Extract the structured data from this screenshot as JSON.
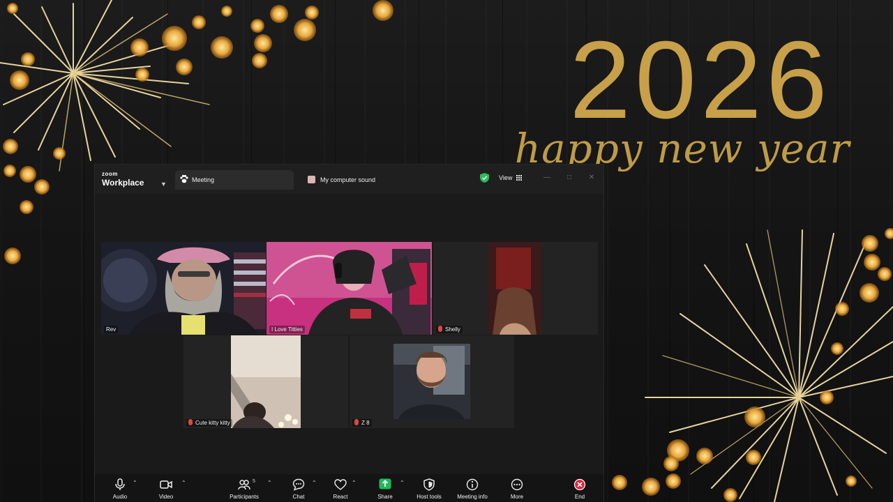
{
  "wallpaper": {
    "year": "2026",
    "greeting": "happy new year",
    "gold": "#c7a049"
  },
  "app": {
    "logo_small": "zoom",
    "logo_big": "Workplace"
  },
  "tabs": {
    "meeting_label": "Meeting",
    "sound_label": "My computer sound"
  },
  "header": {
    "view_label": "View",
    "security_color": "#2dba5a"
  },
  "participants": {
    "rev": "Rev",
    "active": "I Love Titties",
    "shelly": "Shelly",
    "cute": "Cute kitty kitty",
    "z8": "Z 8"
  },
  "toolbar": {
    "audio": "Audio",
    "video": "Video",
    "participants": "Participants",
    "participants_count": "5",
    "chat": "Chat",
    "react": "React",
    "share": "Share",
    "host_tools": "Host tools",
    "meeting_info": "Meeting info",
    "more": "More",
    "end": "End",
    "share_color": "#1fb95b",
    "end_color": "#e2243f"
  },
  "colors": {
    "active_speaker_border": "#3ad07a",
    "muted": "#e0453f"
  }
}
